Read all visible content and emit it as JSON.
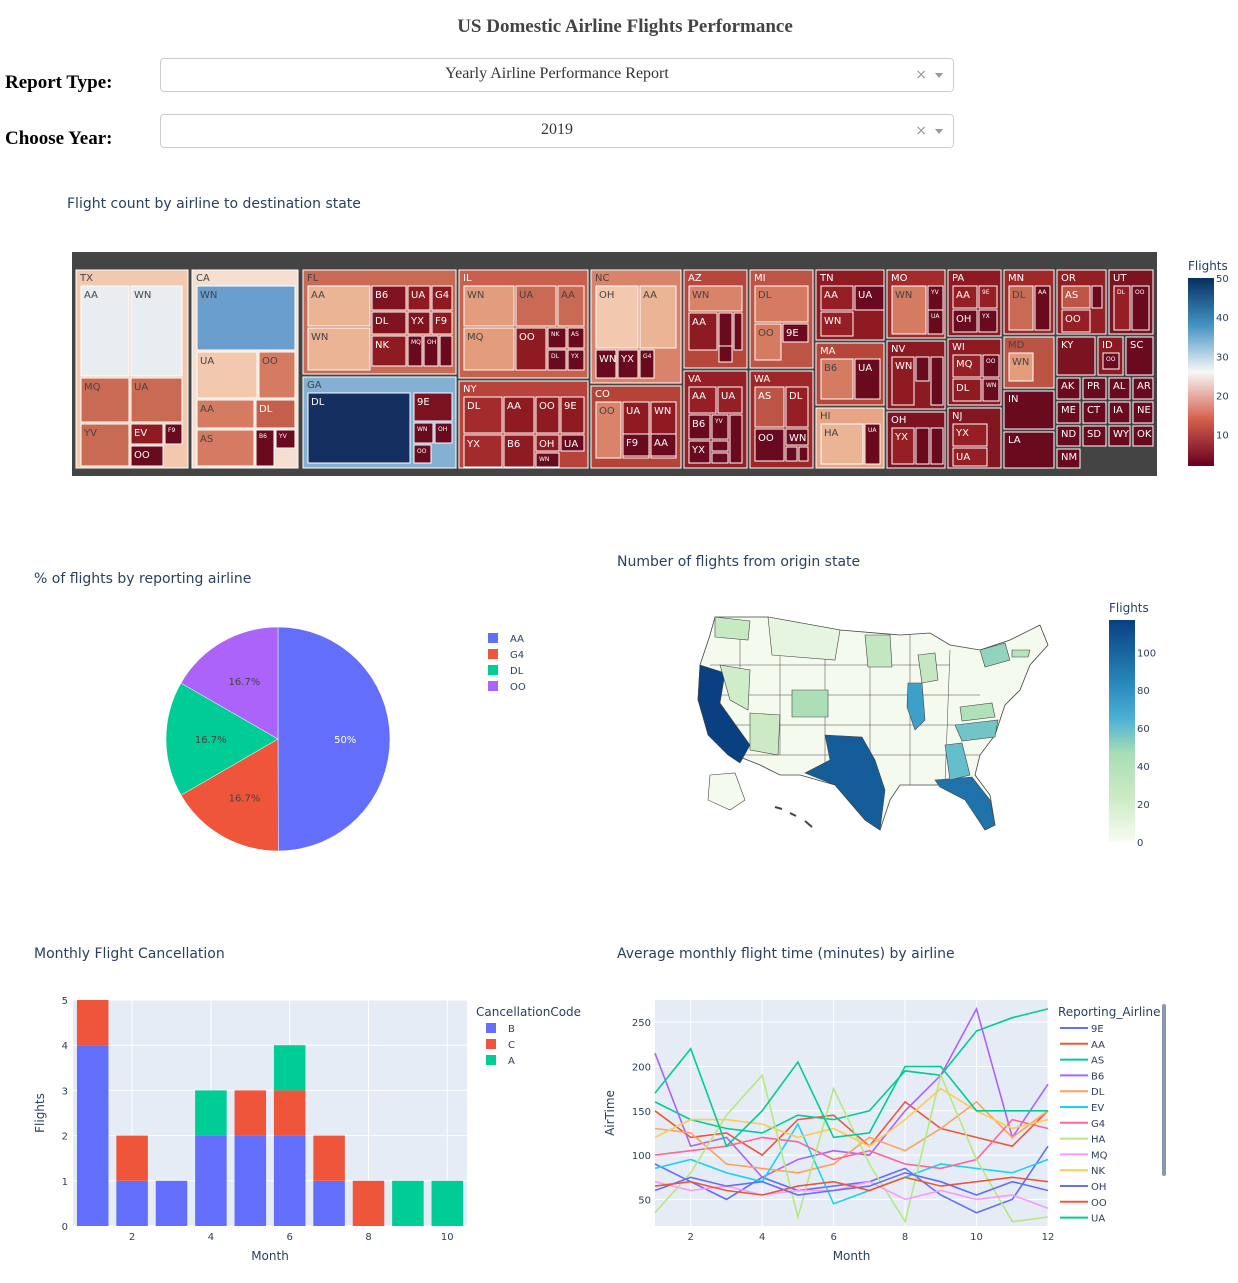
{
  "page": {
    "title": "US Domestic Airline Flights Performance"
  },
  "controls": {
    "report_type": {
      "label": "Report Type:",
      "value": "Yearly Airline Performance Report",
      "clear": "×"
    },
    "year": {
      "label": "Choose Year:",
      "value": "2019",
      "clear": "×"
    }
  },
  "colors": {
    "plot_bg": "#e5ecf6",
    "text": "#2a3f5f",
    "treemap_bg": "#444444"
  },
  "chart_data": [
    {
      "type": "treemap",
      "title": "Flight count by airline to destination state",
      "colorbar": {
        "title": "Flights",
        "ticks": [
          10,
          20,
          30,
          40,
          50
        ],
        "colorscale": "RdBu"
      },
      "states": [
        {
          "name": "TX",
          "children": [
            "AA",
            "WN",
            "MQ",
            "UA",
            "YV",
            "EV",
            "F9",
            "OO"
          ]
        },
        {
          "name": "CA",
          "children": [
            "WN",
            "UA",
            "OO",
            "AA",
            "DL",
            "AS",
            "B6",
            "YV"
          ]
        },
        {
          "name": "FL",
          "children": [
            "AA",
            "B6",
            "UA",
            "G4",
            "DL",
            "YX",
            "F9",
            "WN",
            "NK",
            "MQ",
            "OH",
            "AS"
          ]
        },
        {
          "name": "GA",
          "children": [
            "DL",
            "9E",
            "WN",
            "OH",
            "OO"
          ]
        },
        {
          "name": "IL",
          "children": [
            "WN",
            "UA",
            "AA",
            "MQ",
            "OO",
            "NK",
            "AS",
            "DL",
            "YX"
          ]
        },
        {
          "name": "NY",
          "children": [
            "DL",
            "AA",
            "OO",
            "9E",
            "YX",
            "B6",
            "OH",
            "UA",
            "WN"
          ]
        },
        {
          "name": "NC",
          "children": [
            "OH",
            "AA",
            "WN",
            "YX",
            "G4"
          ]
        },
        {
          "name": "CO",
          "children": [
            "OO",
            "UA",
            "WN",
            "F9",
            "AA"
          ]
        },
        {
          "name": "AZ",
          "children": [
            "WN",
            "AA",
            "OO",
            "YV",
            "UA"
          ]
        },
        {
          "name": "VA",
          "children": [
            "AA",
            "UA",
            "B6",
            "YV",
            "YX",
            "MQ",
            "OH",
            "WN"
          ]
        },
        {
          "name": "MI",
          "children": [
            "DL",
            "OO",
            "9E"
          ]
        },
        {
          "name": "WA",
          "children": [
            "AS",
            "DL",
            "OO",
            "WN",
            "AA",
            "UA"
          ]
        },
        {
          "name": "TN",
          "children": [
            "AA",
            "WN",
            "UA"
          ]
        },
        {
          "name": "MA",
          "children": [
            "B6",
            "UA"
          ]
        },
        {
          "name": "HI",
          "children": [
            "HA",
            "UA"
          ]
        },
        {
          "name": "MO",
          "children": [
            "WN",
            "YV",
            "UA"
          ]
        },
        {
          "name": "NV",
          "children": [
            "WN",
            "UA",
            "NK"
          ]
        },
        {
          "name": "OH",
          "children": [
            "YX",
            "DL",
            "NK"
          ]
        },
        {
          "name": "PA",
          "children": [
            "AA",
            "9E",
            "YX",
            "OH"
          ]
        },
        {
          "name": "WI",
          "children": [
            "MQ",
            "DL",
            "OO",
            "WN"
          ]
        },
        {
          "name": "NJ",
          "children": [
            "YX",
            "UA"
          ]
        },
        {
          "name": "MN",
          "children": [
            "DL",
            "AA"
          ]
        },
        {
          "name": "MD",
          "children": [
            "WN"
          ]
        },
        {
          "name": "IN",
          "children": []
        },
        {
          "name": "LA",
          "children": []
        },
        {
          "name": "OR",
          "children": [
            "AS",
            "UA",
            "OO"
          ]
        },
        {
          "name": "UT",
          "children": [
            "DL",
            "OO"
          ]
        },
        {
          "name": "KY",
          "children": []
        },
        {
          "name": "ID",
          "children": [
            "OO"
          ]
        },
        {
          "name": "SC",
          "children": []
        },
        {
          "name": "AK",
          "children": []
        },
        {
          "name": "PR",
          "children": []
        },
        {
          "name": "AL",
          "children": []
        },
        {
          "name": "AR",
          "children": []
        },
        {
          "name": "ME",
          "children": []
        },
        {
          "name": "CT",
          "children": []
        },
        {
          "name": "IA",
          "children": []
        },
        {
          "name": "NE",
          "children": []
        },
        {
          "name": "ND",
          "children": []
        },
        {
          "name": "SD",
          "children": []
        },
        {
          "name": "WY",
          "children": []
        },
        {
          "name": "OK",
          "children": []
        },
        {
          "name": "NM",
          "children": []
        }
      ]
    },
    {
      "type": "pie",
      "title": "% of flights by reporting airline",
      "labels": [
        "AA",
        "G4",
        "DL",
        "OO"
      ],
      "values": [
        50,
        16.7,
        16.7,
        16.7
      ],
      "text": [
        "50%",
        "16.7%",
        "16.7%",
        "16.7%"
      ],
      "colors": [
        "#636efa",
        "#ef553b",
        "#00cc96",
        "#ab63fa"
      ]
    },
    {
      "type": "choropleth",
      "title": "Number of flights from origin state",
      "colorbar": {
        "title": "Flights",
        "ticks": [
          0,
          20,
          40,
          60,
          80,
          100
        ]
      },
      "states": {
        "CA": 117,
        "TX": 103,
        "FL": 92,
        "IL": 70,
        "GA": 55,
        "NC": 52,
        "NY": 45,
        "CO": 38,
        "VA": 35,
        "MA": 33,
        "MN": 25,
        "MI": 24,
        "WA": 22,
        "AZ": 20,
        "NV": 18,
        "MT": 8
      }
    },
    {
      "type": "bar",
      "title": "Monthly Flight Cancellation",
      "xlabel": "Month",
      "ylabel": "Flights",
      "legend_title": "CancellationCode",
      "x": [
        1,
        2,
        3,
        4,
        5,
        6,
        7,
        8,
        9,
        10
      ],
      "xticks": [
        2,
        4,
        6,
        8,
        10
      ],
      "ylim": [
        0,
        5
      ],
      "yticks": [
        0,
        1,
        2,
        3,
        4,
        5
      ],
      "series": [
        {
          "name": "B",
          "color": "#636efa",
          "values": [
            4,
            1,
            1,
            2,
            2,
            2,
            1,
            0,
            0,
            0
          ]
        },
        {
          "name": "C",
          "color": "#ef553b",
          "values": [
            1,
            1,
            0,
            0,
            1,
            1,
            1,
            1,
            0,
            0
          ]
        },
        {
          "name": "A",
          "color": "#00cc96",
          "values": [
            0,
            0,
            0,
            1,
            0,
            1,
            0,
            0,
            1,
            1
          ]
        }
      ]
    },
    {
      "type": "line",
      "title": "Average monthly flight time (minutes) by airline",
      "xlabel": "Month",
      "ylabel": "AirTime",
      "legend_title": "Reporting_Airline",
      "x": [
        1,
        2,
        3,
        4,
        5,
        6,
        7,
        8,
        9,
        10,
        11,
        12
      ],
      "xticks": [
        2,
        4,
        6,
        8,
        10,
        12
      ],
      "yticks": [
        50,
        100,
        150,
        200,
        250
      ],
      "ylim": [
        20,
        275
      ],
      "series": [
        {
          "name": "9E",
          "color": "#636efa",
          "values": [
            90,
            70,
            50,
            75,
            60,
            65,
            70,
            85,
            55,
            35,
            50,
            110
          ]
        },
        {
          "name": "AA",
          "color": "#ef553b",
          "values": [
            150,
            120,
            125,
            100,
            140,
            145,
            110,
            160,
            130,
            120,
            110,
            150
          ]
        },
        {
          "name": "AS",
          "color": "#00cc96",
          "values": [
            160,
            140,
            130,
            125,
            145,
            140,
            150,
            195,
            190,
            240,
            255,
            265
          ]
        },
        {
          "name": "B6",
          "color": "#ab63fa",
          "values": [
            215,
            110,
            120,
            75,
            95,
            105,
            100,
            150,
            190,
            265,
            120,
            180
          ]
        },
        {
          "name": "DL",
          "color": "#ffa15a",
          "values": [
            130,
            125,
            90,
            85,
            80,
            90,
            120,
            105,
            130,
            160,
            120,
            150
          ]
        },
        {
          "name": "EV",
          "color": "#19d3f3",
          "values": [
            85,
            95,
            80,
            70,
            135,
            45,
            60,
            75,
            90,
            85,
            80,
            95
          ]
        },
        {
          "name": "G4",
          "color": "#ff6692",
          "values": [
            100,
            105,
            110,
            120,
            115,
            95,
            105,
            90,
            85,
            95,
            140,
            130
          ]
        },
        {
          "name": "HA",
          "color": "#b6e880",
          "values": [
            35,
            80,
            145,
            190,
            30,
            175,
            90,
            25,
            190,
            95,
            25,
            30
          ]
        },
        {
          "name": "MQ",
          "color": "#ff97ff",
          "values": [
            70,
            60,
            65,
            55,
            60,
            60,
            70,
            50,
            60,
            50,
            55,
            40
          ]
        },
        {
          "name": "NK",
          "color": "#fecb52",
          "values": [
            120,
            140,
            140,
            135,
            120,
            130,
            110,
            140,
            175,
            150,
            130,
            140
          ]
        },
        {
          "name": "OH",
          "color": "#636efa",
          "values": [
            60,
            75,
            65,
            70,
            55,
            60,
            65,
            80,
            70,
            55,
            70,
            60
          ]
        },
        {
          "name": "OO",
          "color": "#ef553b",
          "values": [
            65,
            70,
            60,
            55,
            65,
            70,
            60,
            75,
            65,
            70,
            75,
            70
          ]
        },
        {
          "name": "UA",
          "color": "#00cc96",
          "values": [
            170,
            220,
            110,
            150,
            205,
            120,
            125,
            200,
            200,
            150,
            150,
            150
          ]
        }
      ]
    }
  ]
}
